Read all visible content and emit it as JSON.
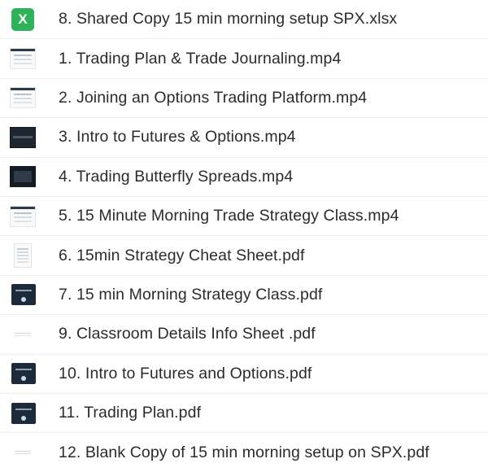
{
  "files": [
    {
      "name": "8. Shared Copy 15 min morning setup SPX.xlsx",
      "icon": "excel-icon",
      "icon_glyph": "X",
      "thumb_style": "xlsx"
    },
    {
      "name": "1. Trading Plan & Trade Journaling.mp4",
      "icon": "video-thumbnail-icon",
      "thumb_style": "light"
    },
    {
      "name": "2. Joining an Options Trading Platform.mp4",
      "icon": "video-thumbnail-icon",
      "thumb_style": "light"
    },
    {
      "name": "3. Intro to Futures & Options.mp4",
      "icon": "video-thumbnail-icon",
      "thumb_style": "dark"
    },
    {
      "name": "4. Trading Butterfly Spreads.mp4",
      "icon": "video-thumbnail-icon",
      "thumb_style": "dark-full"
    },
    {
      "name": "5. 15 Minute Morning Trade Strategy Class.mp4",
      "icon": "video-thumbnail-icon",
      "thumb_style": "light"
    },
    {
      "name": "6. 15min Strategy Cheat Sheet.pdf",
      "icon": "pdf-thumbnail-icon",
      "thumb_style": "doc"
    },
    {
      "name": "7. 15 min Morning Strategy Class.pdf",
      "icon": "pdf-thumbnail-icon",
      "thumb_style": "navy"
    },
    {
      "name": "9. Classroom Details Info Sheet .pdf",
      "icon": "pdf-thumbnail-icon",
      "thumb_style": "faint"
    },
    {
      "name": "10. Intro to Futures and Options.pdf",
      "icon": "pdf-thumbnail-icon",
      "thumb_style": "navy"
    },
    {
      "name": "11. Trading Plan.pdf",
      "icon": "pdf-thumbnail-icon",
      "thumb_style": "navy"
    },
    {
      "name": "12. Blank Copy of 15 min morning setup on SPX.pdf",
      "icon": "pdf-thumbnail-icon",
      "thumb_style": "faint"
    }
  ],
  "colors": {
    "excel_green": "#2fb35a",
    "text": "#2b2b2b",
    "divider": "#ececec",
    "navy_cover": "#1c2a3c"
  }
}
